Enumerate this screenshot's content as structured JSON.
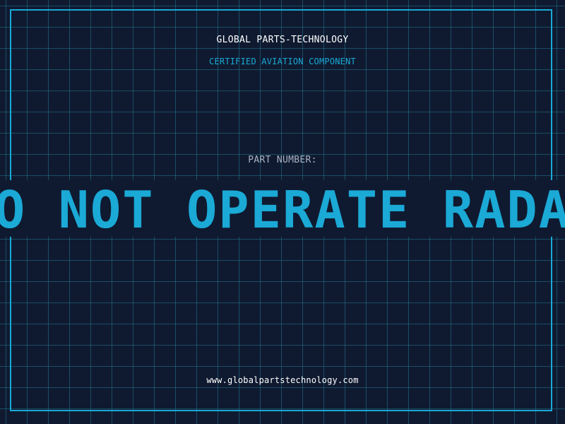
{
  "header": {
    "brand": "GLOBAL PARTS-TECHNOLOGY",
    "tagline": "CERTIFIED AVIATION COMPONENT"
  },
  "part": {
    "label": "PART NUMBER:",
    "value": "DO NOT OPERATE RADAR"
  },
  "footer": {
    "url": "www.globalpartstechnology.com"
  },
  "colors": {
    "background": "#0f1a30",
    "accent": "#1ba9d6",
    "grid": "#258ca5",
    "text": "#ffffff",
    "muted": "#a9b3c5"
  }
}
